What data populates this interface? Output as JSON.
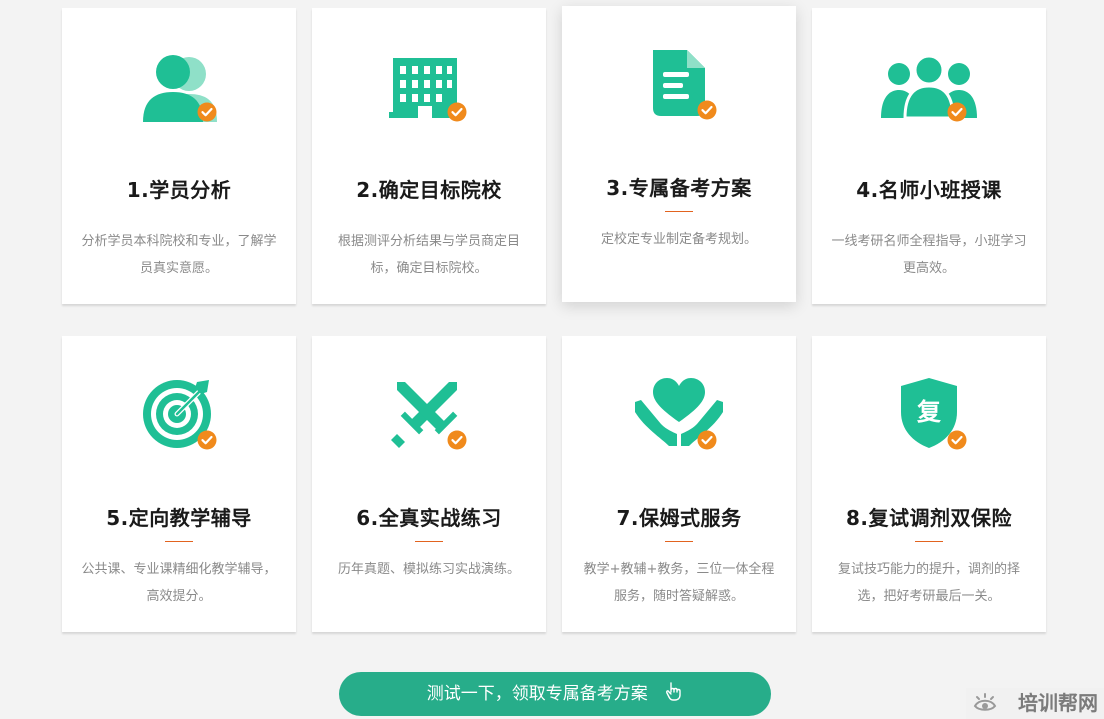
{
  "colors": {
    "accent": "#27ad8a",
    "icon": "#1fbf95",
    "check": "#f08a1c",
    "underline": "#e2631f"
  },
  "cards": [
    {
      "icon": "users-icon",
      "title": "1.学员分析",
      "desc": "分析学员本科院校和专业，了解学员真实意愿。"
    },
    {
      "icon": "building-icon",
      "title": "2.确定目标院校",
      "desc": "根据测评分析结果与学员商定目标，确定目标院校。"
    },
    {
      "icon": "document-icon",
      "title": "3.专属备考方案",
      "desc": "定校定专业制定备考规划。"
    },
    {
      "icon": "group-icon",
      "title": "4.名师小班授课",
      "desc": "一线考研名师全程指导，小班学习更高效。"
    },
    {
      "icon": "target-icon",
      "title": "5.定向教学辅导",
      "desc": "公共课、专业课精细化教学辅导，高效提分。"
    },
    {
      "icon": "crossed-swords-icon",
      "title": "6.全真实战练习",
      "desc": "历年真题、模拟练习实战演练。"
    },
    {
      "icon": "heart-hands-icon",
      "title": "7.保姆式服务",
      "desc": "教学+教辅+教务，三位一体全程服务，随时答疑解惑。"
    },
    {
      "icon": "shield-icon",
      "title": "8.复试调剂双保险",
      "desc": "复试技巧能力的提升，调剂的择选，把好考研最后一关。"
    }
  ],
  "shield_glyph": "复",
  "cta": {
    "label": "测试一下，领取专属备考方案"
  },
  "watermark": {
    "text": "培训帮网"
  }
}
